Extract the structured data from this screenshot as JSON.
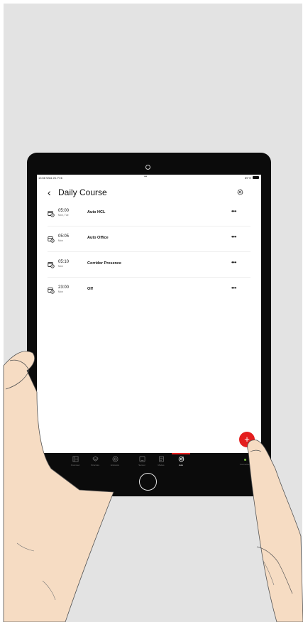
{
  "status_bar": {
    "time": "13:58  Wed 26. Feb",
    "center_dots": "•••",
    "battery": "89 %"
  },
  "header": {
    "back_symbol": "‹",
    "title": "Daily Course",
    "settings_icon": "gear-icon"
  },
  "items": [
    {
      "time": "05:00",
      "days": "Mon, Tue",
      "name": "Auto HCL",
      "menu": "•••"
    },
    {
      "time": "05:05",
      "days": "Mon",
      "name": "Auto Office",
      "menu": "•••"
    },
    {
      "time": "05:10",
      "days": "Mon",
      "name": "Corridor Presence",
      "menu": "•••"
    },
    {
      "time": "23:00",
      "days": "Mon",
      "name": "Off",
      "menu": "•••"
    }
  ],
  "fab": {
    "label": "+"
  },
  "tabs": [
    {
      "label": "Overview",
      "icon": "layout-icon"
    },
    {
      "label": "Structure",
      "icon": "layers-icon"
    },
    {
      "label": "Emission",
      "icon": "target-icon"
    },
    {
      "label": "Sensor",
      "icon": "sensor-icon"
    },
    {
      "label": "Modes",
      "icon": "list-icon"
    },
    {
      "label": "Auto",
      "icon": "auto-icon",
      "active": true
    }
  ],
  "connection": {
    "label": "Connected",
    "status_color": "#7ac143"
  },
  "colors": {
    "accent": "#e41e1e",
    "device": "#0b0b0b",
    "backdrop": "#e3e3e3"
  }
}
